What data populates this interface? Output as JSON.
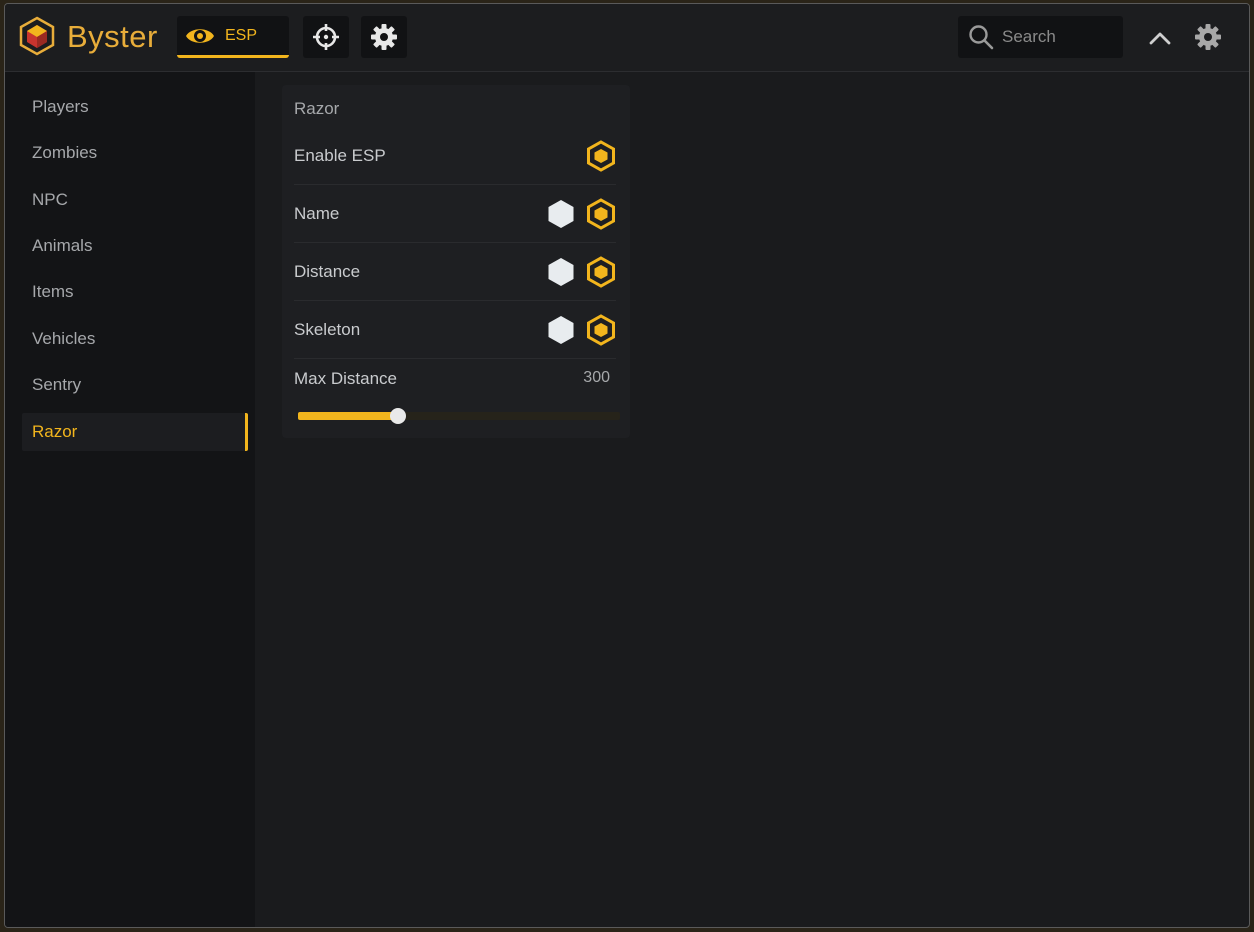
{
  "app": {
    "brand": "Byster",
    "accent_color": "#f2b51d"
  },
  "header": {
    "tabs": [
      {
        "label": "ESP",
        "icon": "eye-icon",
        "active": true
      },
      {
        "label": "",
        "icon": "crosshair-icon",
        "active": false
      },
      {
        "label": "",
        "icon": "gear-icon",
        "active": false
      }
    ],
    "search": {
      "placeholder": "Search",
      "value": ""
    },
    "collapse_icon": "chevron-up-icon",
    "settings_icon": "gear-icon"
  },
  "sidebar": {
    "items": [
      {
        "label": "Players"
      },
      {
        "label": "Zombies"
      },
      {
        "label": "NPC"
      },
      {
        "label": "Animals"
      },
      {
        "label": "Items"
      },
      {
        "label": "Vehicles"
      },
      {
        "label": "Sentry"
      },
      {
        "label": "Razor",
        "active": true
      }
    ]
  },
  "panel": {
    "title": "Razor",
    "rows": [
      {
        "label": "Enable ESP",
        "has_color": false,
        "toggle_on": true
      },
      {
        "label": "Name",
        "has_color": true,
        "color": "#e8ecef",
        "toggle_on": true
      },
      {
        "label": "Distance",
        "has_color": true,
        "color": "#e8ecef",
        "toggle_on": true
      },
      {
        "label": "Skeleton",
        "has_color": true,
        "color": "#e8ecef",
        "toggle_on": true
      }
    ],
    "slider": {
      "label": "Max Distance",
      "value": "300",
      "fraction": 0.31
    }
  }
}
